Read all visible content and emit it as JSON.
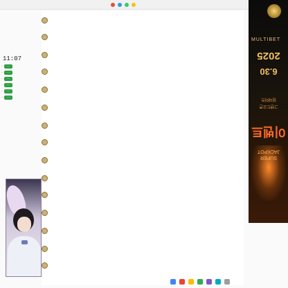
{
  "clock": "11:07",
  "left_stats": [
    {
      "label": "·",
      "value": "···"
    },
    {
      "label": "·",
      "value": "···"
    },
    {
      "label": "·",
      "value": "···"
    },
    {
      "label": "·",
      "value": "···"
    },
    {
      "label": "·",
      "value": "···"
    },
    {
      "label": "·",
      "value": "···"
    }
  ],
  "feed": {
    "posts": [
      {
        "name": "",
        "body": "",
        "meta": ""
      },
      {
        "name": "",
        "body": "",
        "meta": ""
      },
      {
        "name": "",
        "body": "",
        "meta": ""
      },
      {
        "name": "",
        "body": "",
        "meta": ""
      },
      {
        "name": "",
        "body": "",
        "meta": ""
      },
      {
        "name": "",
        "body": "",
        "meta": ""
      },
      {
        "name": "",
        "body": "",
        "meta": ""
      },
      {
        "name": "",
        "body": "",
        "meta": ""
      },
      {
        "name": "",
        "body": "",
        "meta": ""
      },
      {
        "name": "",
        "body": "",
        "meta": ""
      },
      {
        "name": "",
        "body": "",
        "meta": ""
      },
      {
        "name": "",
        "body": "",
        "meta": ""
      },
      {
        "name": "",
        "body": "",
        "meta": ""
      },
      {
        "name": "",
        "body": "",
        "meta": ""
      },
      {
        "name": "",
        "body": "",
        "meta": ""
      }
    ]
  },
  "ad": {
    "brand": "MULTIBET",
    "year": "2025",
    "date": "6.30",
    "line1": "업데이트",
    "line2": "그랜드오픈",
    "promo": "이벤트",
    "tag": "SUPER JACKPOT"
  },
  "colors": {
    "accent": "#3a6ea5",
    "stat_green": "#2f9e44",
    "ad_gold": "#d9b36a",
    "ad_orange": "#ff6a2a"
  },
  "icons": [
    "avatar-icon",
    "crest-icon",
    "taskbar-icon"
  ]
}
